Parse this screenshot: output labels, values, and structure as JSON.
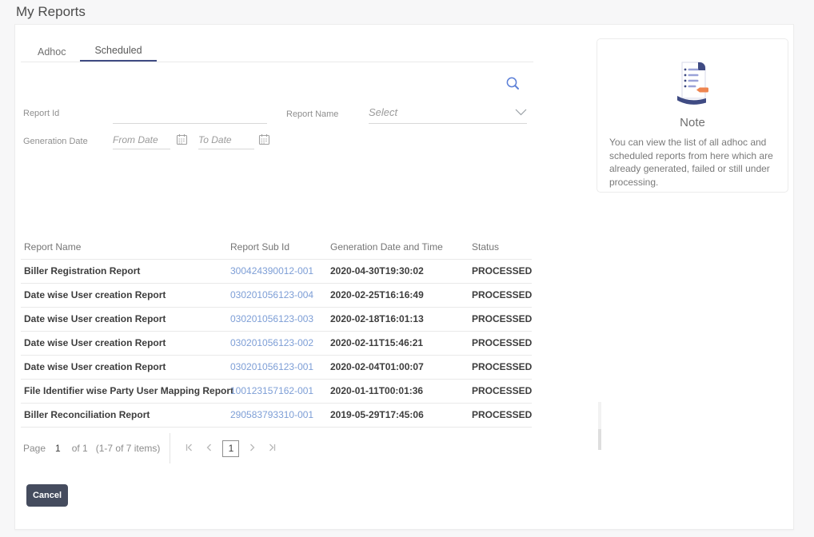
{
  "page": {
    "title": "My Reports"
  },
  "tabs": [
    {
      "label": "Adhoc",
      "active": false
    },
    {
      "label": "Scheduled",
      "active": true
    }
  ],
  "filters": {
    "report_id": {
      "label": "Report Id",
      "value": ""
    },
    "report_name": {
      "label": "Report Name",
      "placeholder": "Select"
    },
    "generation_date": {
      "label": "Generation Date",
      "from_placeholder": "From Date",
      "to_placeholder": "To Date"
    }
  },
  "table": {
    "columns": [
      "Report Name",
      "Report Sub Id",
      "Generation Date and Time",
      "Status"
    ],
    "rows": [
      {
        "name": "Biller Registration Report",
        "sub_id": "300424390012-001",
        "generated": "2020-04-30T19:30:02",
        "status": "PROCESSED"
      },
      {
        "name": "Date wise User creation Report",
        "sub_id": "030201056123-004",
        "generated": "2020-02-25T16:16:49",
        "status": "PROCESSED"
      },
      {
        "name": "Date wise User creation Report",
        "sub_id": "030201056123-003",
        "generated": "2020-02-18T16:01:13",
        "status": "PROCESSED"
      },
      {
        "name": "Date wise User creation Report",
        "sub_id": "030201056123-002",
        "generated": "2020-02-11T15:46:21",
        "status": "PROCESSED"
      },
      {
        "name": "Date wise User creation Report",
        "sub_id": "030201056123-001",
        "generated": "2020-02-04T01:00:07",
        "status": "PROCESSED"
      },
      {
        "name": "File Identifier wise Party User Mapping Report",
        "sub_id": "100123157162-001",
        "generated": "2020-01-11T00:01:36",
        "status": "PROCESSED"
      },
      {
        "name": "Biller Reconciliation Report",
        "sub_id": "290583793310-001",
        "generated": "2019-05-29T17:45:06",
        "status": "PROCESSED"
      }
    ]
  },
  "pagination": {
    "page_label": "Page",
    "current_page": "1",
    "of_text": "of 1",
    "items_text": "(1-7 of 7 items)",
    "page_box": "1"
  },
  "note": {
    "title": "Note",
    "body": "You can view the list of all adhoc and scheduled reports from here which are already generated, failed or still under processing."
  },
  "actions": {
    "cancel": "Cancel"
  },
  "icons": {
    "search": "magnifier",
    "report_name_dropdown": "chevron-down",
    "date_pickers": "calendar",
    "note": "report-document",
    "pagination": [
      "first-page",
      "previous-page",
      "next-page",
      "last-page"
    ]
  },
  "colors": {
    "accent": "#3f4b83",
    "link": "#7d9ed6",
    "search_icon": "#5b7fd7",
    "cancel_bg": "#454c5e",
    "note_icon_orange": "#ee8550",
    "text_dark": "#3d3d3d",
    "text_muted": "#8f8f8f",
    "page_bg": "#f7f7f8"
  }
}
